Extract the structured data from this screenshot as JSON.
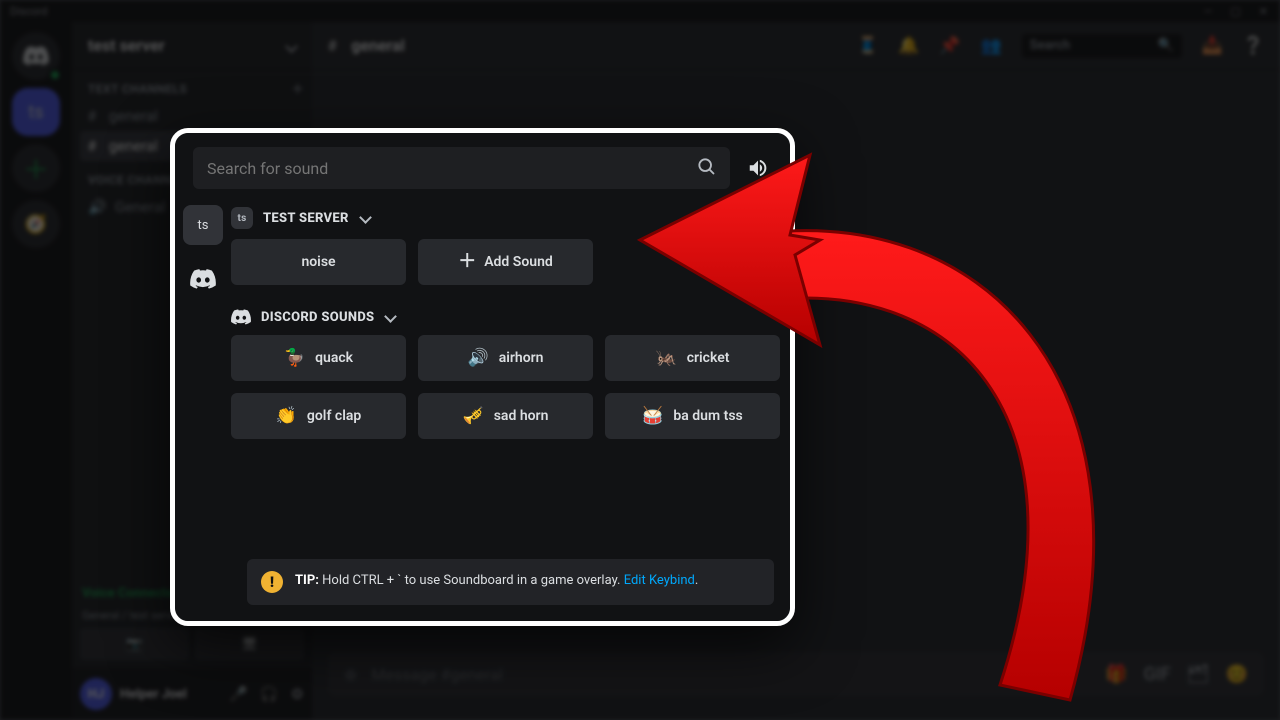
{
  "titlebar": {
    "app_name": "Discord"
  },
  "server": {
    "name": "test server"
  },
  "channel_sections": {
    "text_label": "TEXT CHANNELS",
    "voice_label": "VOICE CHANNELS"
  },
  "channels": {
    "text": [
      "general",
      "general"
    ],
    "voice": [
      "General"
    ],
    "active_text": "general"
  },
  "voice_status": {
    "label": "Voice Connected",
    "sub": "General / test server"
  },
  "user": {
    "name": "Helper Joel"
  },
  "chat": {
    "header_channel": "general",
    "input_placeholder": "Message #general"
  },
  "header_search": {
    "placeholder": "Search"
  },
  "soundboard": {
    "search_placeholder": "Search for sound",
    "sources": [
      {
        "id": "ts",
        "label": "ts"
      },
      {
        "id": "discord",
        "label": "discord"
      }
    ],
    "groups": [
      {
        "id": "test-server",
        "badge": "ts",
        "title": "TEST SERVER",
        "add_label": "Add Sound",
        "sounds": [
          {
            "name": "noise",
            "emoji": ""
          }
        ]
      },
      {
        "id": "discord-sounds",
        "badge": "discord-logo",
        "title": "DISCORD SOUNDS",
        "sounds": [
          {
            "name": "quack",
            "emoji": "🦆"
          },
          {
            "name": "airhorn",
            "emoji": "🔊"
          },
          {
            "name": "cricket",
            "emoji": "🦗"
          },
          {
            "name": "golf clap",
            "emoji": "👏"
          },
          {
            "name": "sad horn",
            "emoji": "🎺"
          },
          {
            "name": "ba dum tss",
            "emoji": "🥁"
          }
        ]
      }
    ],
    "tip": {
      "prefix": "TIP:",
      "body": " Hold CTRL + ` to use Soundboard in a game overlay. ",
      "link": "Edit Keybind",
      "suffix": "."
    }
  }
}
